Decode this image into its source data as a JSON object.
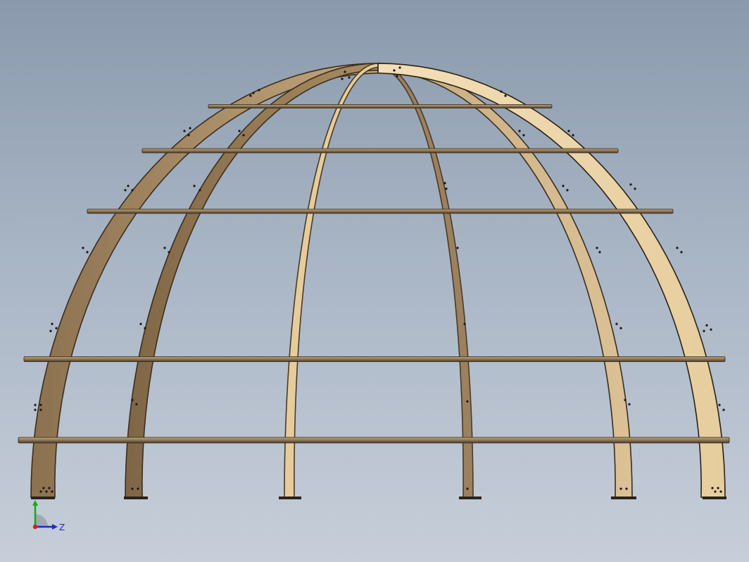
{
  "viewport": {
    "background_top": "#8a9aac",
    "background_bottom": "#c7ced9"
  },
  "model": {
    "type": "dome-frame",
    "arch_color": "#b89a6e",
    "arch_light": "#e8d2a8",
    "arch_dark": "#7a6244",
    "ring_color": "#8a7454",
    "visible_arches": 6,
    "horizontal_rings": 5
  },
  "triad": {
    "y_label": "",
    "z_label": "Z",
    "x_color": "#d42020",
    "y_color": "#18a818",
    "z_color": "#1a2eb8"
  }
}
